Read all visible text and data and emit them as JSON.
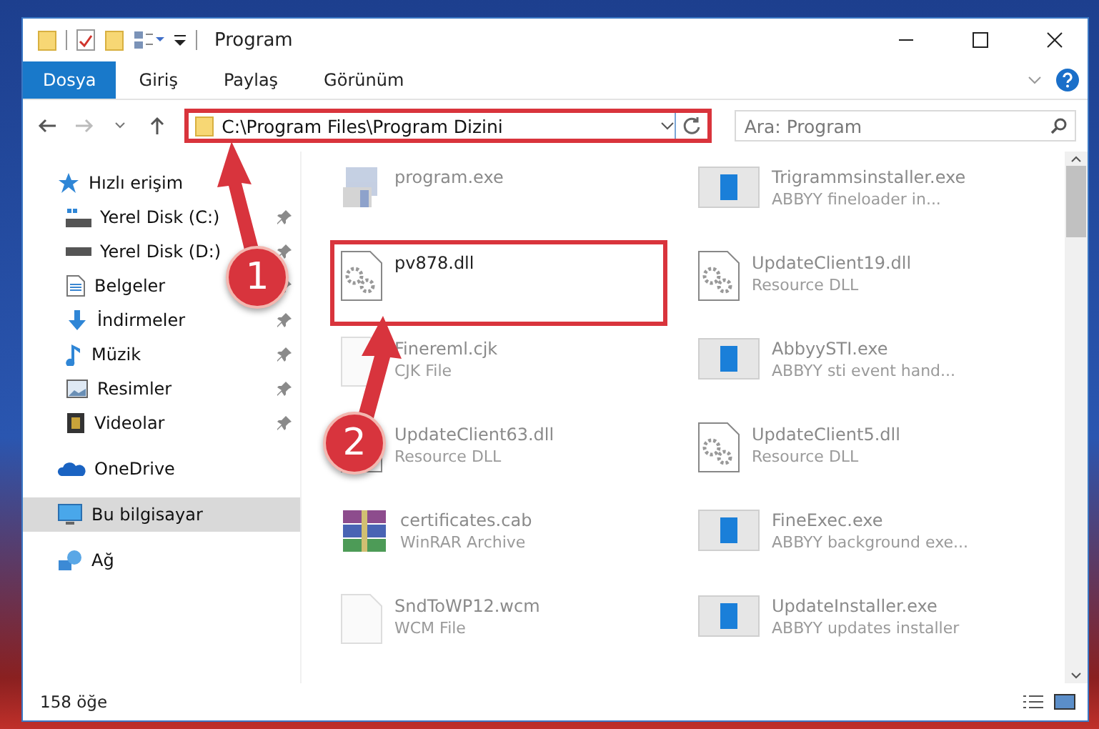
{
  "window": {
    "title": "Program"
  },
  "ribbon_tabs": [
    {
      "label": "Dosya",
      "kind": "file"
    },
    {
      "label": "Giriş",
      "kind": "tab"
    },
    {
      "label": "Paylaş",
      "kind": "tab"
    },
    {
      "label": "Görünüm",
      "kind": "tab"
    }
  ],
  "address_bar": {
    "path": "C:\\Program Files\\Program Dizini",
    "highlighted": true
  },
  "search": {
    "placeholder": "Ara: Program"
  },
  "sidebar": {
    "items": [
      {
        "label": "Hızlı erişim",
        "selected": false,
        "children": [
          {
            "label": "Yerel Disk (C:)",
            "pinned": true
          },
          {
            "label": "Yerel Disk (D:)",
            "pinned": true
          },
          {
            "label": "Belgeler",
            "pinned": true
          },
          {
            "label": "İndirmeler",
            "pinned": true
          },
          {
            "label": "Müzik",
            "pinned": true
          },
          {
            "label": "Resimler",
            "pinned": true
          },
          {
            "label": "Videolar",
            "pinned": true
          }
        ]
      },
      {
        "label": "OneDrive",
        "selected": false
      },
      {
        "label": "Bu bilgisayar",
        "selected": true
      },
      {
        "label": "Ağ",
        "selected": false
      }
    ]
  },
  "files": [
    {
      "name": "program.exe",
      "kind": "setup",
      "highlighted": false,
      "faded": true
    },
    {
      "name": "Trigrammsinstaller.exe",
      "type": "ABBYY fineloader in...",
      "kind": "app",
      "highlighted": false,
      "faded": true
    },
    {
      "name": "pv878.dll",
      "kind": "dll",
      "highlighted": true,
      "faded": false
    },
    {
      "name": "UpdateClient19.dll",
      "type": "Resource DLL",
      "kind": "dll",
      "highlighted": false,
      "faded": true
    },
    {
      "name": "Finereml.cjk",
      "type": "CJK File",
      "kind": "blank",
      "highlighted": false,
      "faded": true
    },
    {
      "name": "AbbyySTI.exe",
      "type": "ABBYY sti event hand...",
      "kind": "app",
      "highlighted": false,
      "faded": true
    },
    {
      "name": "UpdateClient63.dll",
      "type": "Resource DLL",
      "kind": "dll",
      "highlighted": false,
      "faded": true
    },
    {
      "name": "UpdateClient5.dll",
      "type": "Resource DLL",
      "kind": "dll",
      "highlighted": false,
      "faded": true
    },
    {
      "name": "certificates.cab",
      "type": "WinRAR Archive",
      "kind": "archive",
      "highlighted": false,
      "faded": true
    },
    {
      "name": "FineExec.exe",
      "type": "ABBYY background exe...",
      "kind": "app",
      "highlighted": false,
      "faded": true
    },
    {
      "name": "SndToWP12.wcm",
      "type": "WCM File",
      "kind": "blank",
      "highlighted": false,
      "faded": true
    },
    {
      "name": "UpdateInstaller.exe",
      "type": "ABBYY updates installer",
      "kind": "app",
      "highlighted": false,
      "faded": true
    }
  ],
  "annotations": [
    {
      "number": "1"
    },
    {
      "number": "2"
    }
  ],
  "status_bar": {
    "item_count": "158 öğe"
  }
}
